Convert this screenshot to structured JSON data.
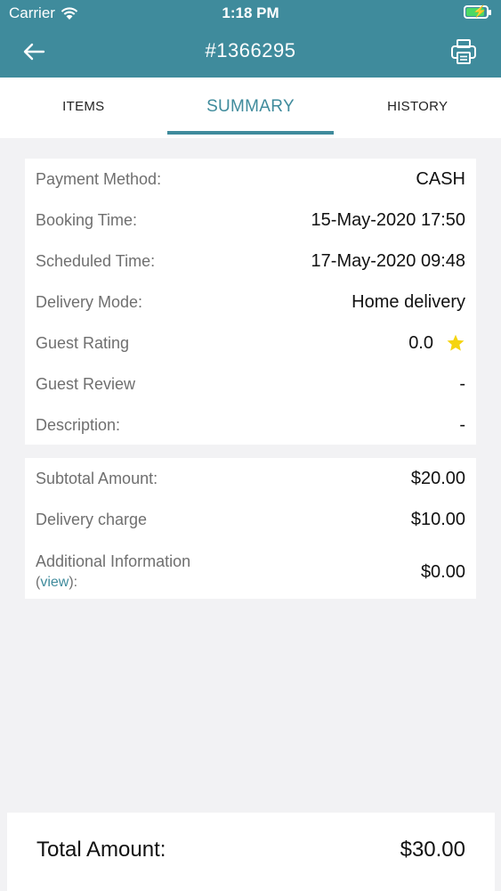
{
  "status_bar": {
    "carrier": "Carrier",
    "time": "1:18 PM"
  },
  "nav": {
    "title": "#1366295"
  },
  "tabs": [
    {
      "label": "ITEMS",
      "active": false
    },
    {
      "label": "SUMMARY",
      "active": true
    },
    {
      "label": "HISTORY",
      "active": false
    }
  ],
  "details": {
    "payment_method": {
      "label": "Payment Method:",
      "value": "CASH"
    },
    "booking_time": {
      "label": "Booking Time:",
      "value": "15-May-2020 17:50"
    },
    "scheduled_time": {
      "label": "Scheduled Time:",
      "value": "17-May-2020 09:48"
    },
    "delivery_mode": {
      "label": "Delivery Mode:",
      "value": "Home delivery"
    },
    "guest_rating": {
      "label": "Guest Rating",
      "value": "0.0"
    },
    "guest_review": {
      "label": "Guest Review",
      "value": "-"
    },
    "description": {
      "label": "Description:",
      "value": "-"
    }
  },
  "charges": {
    "subtotal": {
      "label": "Subtotal Amount:",
      "value": "$20.00"
    },
    "delivery": {
      "label": "Delivery charge",
      "value": "$10.00"
    },
    "additional": {
      "label_line1": "Additional Information",
      "paren_open": "(",
      "link": "view",
      "paren_close": "):",
      "value": "$0.00"
    }
  },
  "total": {
    "label": "Total Amount:",
    "value": "$30.00"
  },
  "colors": {
    "primary": "#3f8b9c",
    "star": "#f5d40f",
    "battery": "#4cd964"
  }
}
